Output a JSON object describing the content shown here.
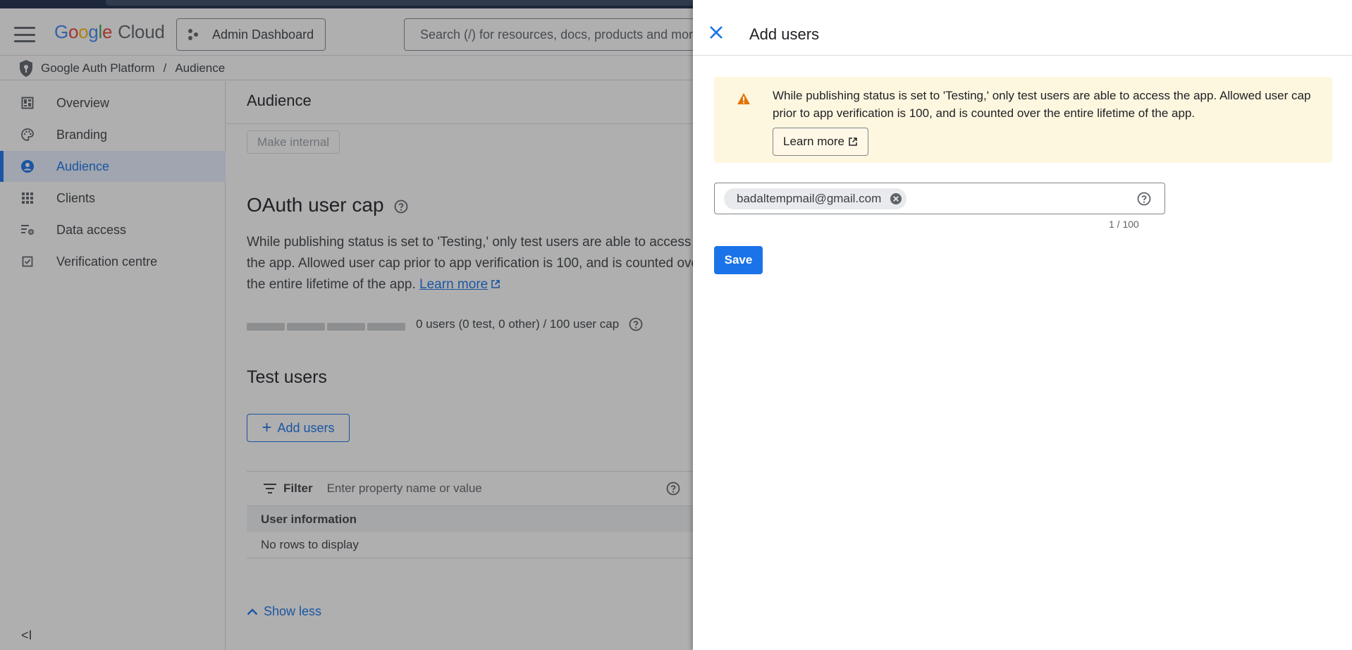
{
  "header": {
    "logo_letters": [
      "G",
      "o",
      "o",
      "g",
      "l",
      "e"
    ],
    "logo_suffix": "Cloud",
    "project_button": "Admin Dashboard",
    "search_placeholder": "Search (/) for resources, docs, products and more"
  },
  "breadcrumb": {
    "items": [
      "Google Auth Platform",
      "Audience"
    ],
    "separator": "/"
  },
  "sidebar": {
    "items": [
      {
        "label": "Overview",
        "icon": "dashboard-icon"
      },
      {
        "label": "Branding",
        "icon": "palette-icon"
      },
      {
        "label": "Audience",
        "icon": "person-icon",
        "active": true
      },
      {
        "label": "Clients",
        "icon": "grid-icon"
      },
      {
        "label": "Data access",
        "icon": "data-settings-icon"
      },
      {
        "label": "Verification centre",
        "icon": "checkbox-icon"
      }
    ],
    "collapse_glyph": "<I"
  },
  "main": {
    "title": "Audience",
    "make_internal": "Make internal",
    "oauth_heading": "OAuth user cap",
    "oauth_text": "While publishing status is set to 'Testing,' only test users are able to access the app. Allowed user cap prior to app verification is 100, and is counted over the entire lifetime of the app.",
    "oauth_link": "Learn more",
    "user_count": 0,
    "user_cap": 100,
    "progress_fraction": 0,
    "progress_label": "0 users (0 test, 0 other) / 100 user cap",
    "test_users_heading": "Test users",
    "add_users_button": "Add users",
    "filter_label": "Filter",
    "filter_placeholder": "Enter property name or value",
    "table_header": "User information",
    "table_empty": "No rows to display",
    "show_less": "Show less"
  },
  "panel": {
    "title": "Add users",
    "banner_text": "While publishing status is set to 'Testing,' only test users are able to access the app. Allowed user cap prior to app verification is 100, and is counted over the entire lifetime of the app.",
    "banner_button": "Learn more",
    "emails": [
      "badaltempmail@gmail.com"
    ],
    "counter": "1 / 100",
    "save_button": "Save"
  },
  "colors": {
    "accent": "#1a73e8",
    "warning": "#e37400",
    "banner_bg": "#fef7e0",
    "active_nav_bg": "#e8f0fe"
  }
}
